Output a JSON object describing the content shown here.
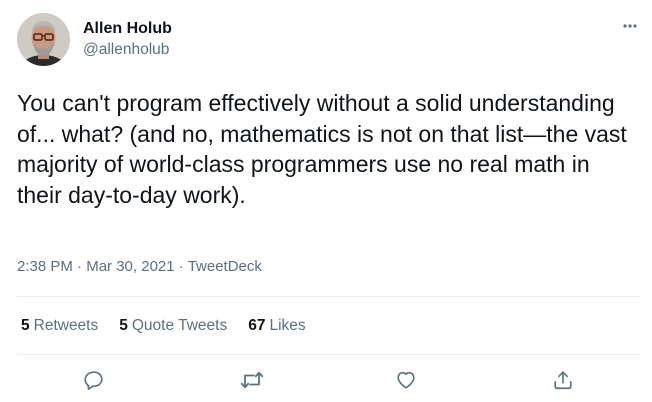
{
  "author": {
    "name": "Allen Holub",
    "handle": "@allenholub"
  },
  "tweet": {
    "text": "You can't program effectively without a solid understanding of... what? (and no, mathematics is not on that list—the vast majority of world-class programmers use no real math in their day-to-day work).",
    "time": "2:38 PM",
    "date": "Mar 30, 2021",
    "source": "TweetDeck",
    "separator": "·"
  },
  "stats": {
    "retweets_count": "5",
    "retweets_label": "Retweets",
    "quote_tweets_count": "5",
    "quote_tweets_label": "Quote Tweets",
    "likes_count": "67",
    "likes_label": "Likes"
  },
  "icons": {
    "more": "more-horizontal-icon",
    "reply": "reply-icon",
    "retweet": "retweet-icon",
    "like": "heart-icon",
    "share": "share-icon"
  },
  "colors": {
    "text": "#0f1419",
    "secondary": "#5b7083",
    "divider": "#e6ecf0"
  }
}
